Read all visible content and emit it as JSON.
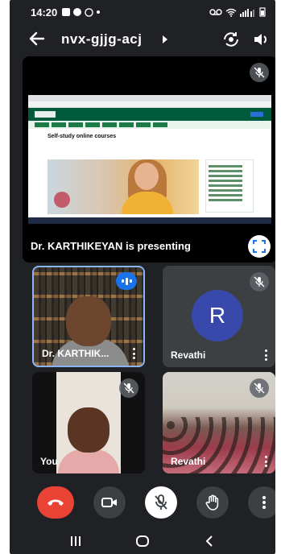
{
  "status_bar": {
    "time": "14:20"
  },
  "meeting": {
    "code": "nvx-gjjg-acj"
  },
  "presentation": {
    "presenter_label": "Dr. KARTHIKEYAN is presenting",
    "shared_page": {
      "heading": "Self-study online courses"
    }
  },
  "participants": [
    {
      "name": "Dr. KARTHIK...",
      "state": "speaking",
      "video": true
    },
    {
      "name": "Revathi",
      "state": "muted",
      "video": false,
      "avatar_letter": "R",
      "avatar_color": "#3949ab"
    },
    {
      "name": "You",
      "state": "muted",
      "video": true
    },
    {
      "name": "Revathi",
      "state": "muted",
      "video": true
    }
  ],
  "controls": {
    "end_call_color": "#ea4335",
    "icons": [
      "end-call-icon",
      "camera-icon",
      "mic-off-icon",
      "raise-hand-icon",
      "more-vert-icon"
    ]
  },
  "colors": {
    "background": "#202124",
    "tile": "#3c4043",
    "accent": "#1a73e8",
    "active_border": "#8ab4f8"
  }
}
